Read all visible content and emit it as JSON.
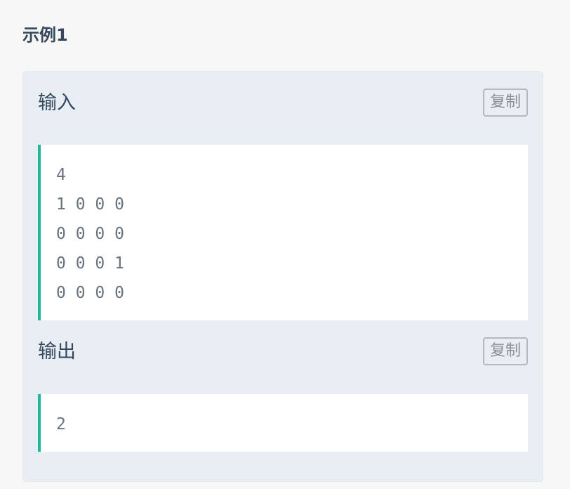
{
  "example": {
    "title": "示例1"
  },
  "input": {
    "label": "输入",
    "copy_label": "复制",
    "lines": [
      "4",
      "1 0 0 0",
      "0 0 0 0",
      "0 0 0 1",
      "0 0 0 0"
    ]
  },
  "output": {
    "label": "输出",
    "copy_label": "复制",
    "lines": [
      "2"
    ]
  },
  "colors": {
    "accent": "#1abc9c",
    "card_bg": "#e9eef5",
    "text": "#34495e"
  }
}
